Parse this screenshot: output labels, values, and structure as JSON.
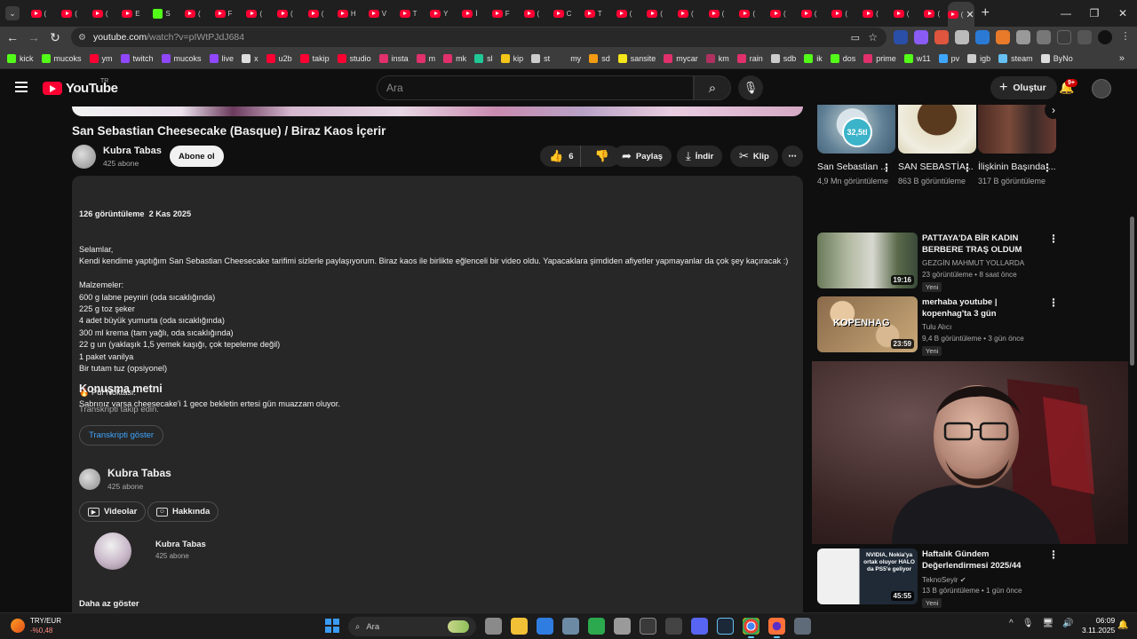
{
  "browser": {
    "tabs": [
      {
        "icon": "youtube",
        "letter": "("
      },
      {
        "icon": "youtube",
        "letter": "("
      },
      {
        "icon": "youtube",
        "letter": "("
      },
      {
        "icon": "youtube",
        "letter": "E"
      },
      {
        "icon": "kick",
        "letter": "S"
      },
      {
        "icon": "youtube",
        "letter": "("
      },
      {
        "icon": "youtube",
        "letter": "F"
      },
      {
        "icon": "youtube",
        "letter": "("
      },
      {
        "icon": "youtube",
        "letter": "("
      },
      {
        "icon": "youtube",
        "letter": "("
      },
      {
        "icon": "youtube",
        "letter": "H"
      },
      {
        "icon": "youtube",
        "letter": "V"
      },
      {
        "icon": "youtube",
        "letter": "T"
      },
      {
        "icon": "youtube",
        "letter": "Y"
      },
      {
        "icon": "youtube",
        "letter": "İ"
      },
      {
        "icon": "youtube",
        "letter": "F"
      },
      {
        "icon": "youtube",
        "letter": "("
      },
      {
        "icon": "youtube",
        "letter": "C"
      },
      {
        "icon": "youtube",
        "letter": "T"
      },
      {
        "icon": "youtube",
        "letter": "("
      },
      {
        "icon": "youtube",
        "letter": "("
      },
      {
        "icon": "youtube",
        "letter": "("
      },
      {
        "icon": "youtube",
        "letter": "("
      },
      {
        "icon": "youtube",
        "letter": "("
      },
      {
        "icon": "youtube",
        "letter": "("
      },
      {
        "icon": "youtube",
        "letter": "("
      },
      {
        "icon": "youtube",
        "letter": "("
      },
      {
        "icon": "youtube",
        "letter": "("
      },
      {
        "icon": "youtube",
        "letter": "("
      },
      {
        "icon": "youtube",
        "letter": "("
      }
    ],
    "active_tab_letter": "(",
    "url_host": "youtube.com",
    "url_rest": "/watch?v=pIWtPJdJ684",
    "bookmarks": [
      {
        "label": "kick",
        "color": "#53fc18"
      },
      {
        "label": "mucoks",
        "color": "#53fc18"
      },
      {
        "label": "ym",
        "color": "#ff0033"
      },
      {
        "label": "twitch",
        "color": "#9146ff"
      },
      {
        "label": "mucoks",
        "color": "#9146ff"
      },
      {
        "label": "live",
        "color": "#9146ff"
      },
      {
        "label": "x",
        "color": "#dddddd"
      },
      {
        "label": "u2b",
        "color": "#ff0033"
      },
      {
        "label": "takip",
        "color": "#ff0033"
      },
      {
        "label": "studio",
        "color": "#ff0033"
      },
      {
        "label": "insta",
        "color": "#e1306c"
      },
      {
        "label": "m",
        "color": "#e1306c"
      },
      {
        "label": "mk",
        "color": "#e1306c"
      },
      {
        "label": "sl",
        "color": "#20c997"
      },
      {
        "label": "kip",
        "color": "#f5c518"
      },
      {
        "label": "st",
        "color": "#cccccc"
      },
      {
        "label": "my",
        "color": "#3c3c3c"
      },
      {
        "label": "sd",
        "color": "#f39c12"
      },
      {
        "label": "sansite",
        "color": "#f5e61a"
      },
      {
        "label": "mycar",
        "color": "#e1306c"
      },
      {
        "label": "km",
        "color": "#b03060"
      },
      {
        "label": "rain",
        "color": "#e1306c"
      },
      {
        "label": "sdb",
        "color": "#cccccc"
      },
      {
        "label": "ik",
        "color": "#53fc18"
      },
      {
        "label": "dos",
        "color": "#53fc18"
      },
      {
        "label": "prime",
        "color": "#e1306c"
      },
      {
        "label": "w11",
        "color": "#53fc18"
      },
      {
        "label": "pv",
        "color": "#3ea6ff"
      },
      {
        "label": "igb",
        "color": "#cccccc"
      },
      {
        "label": "steam",
        "color": "#66c0f4"
      },
      {
        "label": "ByNo",
        "color": "#dddddd"
      }
    ]
  },
  "yt": {
    "logo_text": "YouTube",
    "logo_region": "TR",
    "search_placeholder": "Ara",
    "create_label": "Oluştur",
    "notif_count": "9+"
  },
  "video": {
    "title": "San Sebastian Cheesecake (Basque) / Biraz Kaos İçerir",
    "channel": "Kubra Tabas",
    "subs": "425 abone",
    "subscribe_label": "Abone ol",
    "likes": "6",
    "share_label": "Paylaş",
    "download_label": "İndir",
    "clip_label": "Klip"
  },
  "description": {
    "meta": "126 görüntüleme  2 Kas 2025",
    "lines": [
      "Selamlar,",
      "Kendi kendime yaptığım San Sebastian Cheesecake tarifimi sizlerle paylaşıyorum. Biraz kaos ile birlikte eğlenceli bir video oldu. Yapacaklara şimdiden afiyetler yapmayanlar da çok şey kaçıracak :)",
      "",
      "Malzemeler:",
      "600 g labne peyniri (oda sıcaklığında)",
      "225 g toz şeker",
      "4 adet büyük yumurta (oda sıcaklığında)",
      "300 ml krema (tam yağlı, oda sıcaklığında)",
      "22 g un (yaklaşık 1,5 yemek kaşığı, çok tepeleme değil)",
      "1 paket vanilya",
      "Bir tutam tuz (opsiyonel)",
      "",
      "🔥 Püf Noktası:",
      "Sabrınız varsa cheesecake'i 1 gece bekletin ertesi gün muazzam oluyor."
    ],
    "transcript_title": "Konuşma metni",
    "transcript_sub": "Transkripti takip edin.",
    "transcript_btn": "Transkripti göster",
    "channel_name": "Kubra Tabas",
    "channel_subs": "425 abone",
    "videos_btn": "Videolar",
    "about_btn": "Hakkında",
    "channel_card_name": "Kubra Tabas",
    "channel_card_subs": "425 abone",
    "show_less": "Daha az göster"
  },
  "shorts": [
    {
      "title": "San Sebastian ...",
      "views": "4,9 Mn görüntüleme",
      "badge": "32,5tl"
    },
    {
      "title": "SAN SEBASTİA...",
      "views": "863 B görüntüleme",
      "badge": ""
    },
    {
      "title": "İlişkinin Başında ...",
      "views": "317 B görüntüleme",
      "badge": ""
    }
  ],
  "recommendations": [
    {
      "title": "PATTAYA'DA BİR KADIN BERBERE TRAŞ OLDUM",
      "channel": "GEZGİN MAHMUT YOLLARDA",
      "meta": "23 görüntüleme • 8 saat önce",
      "new": "Yeni",
      "duration": "19:16",
      "thumb_text": ""
    },
    {
      "title": "merhaba youtube | kopenhag'ta 3 gün",
      "channel": "Tulu Alıcı",
      "meta": "9,4 B görüntüleme • 3 gün önce",
      "new": "Yeni",
      "duration": "23:59",
      "thumb_text": "KOPENHAG"
    },
    {
      "title": "Haftalık Gündem Değerlendirmesi 2025/44",
      "channel": "TeknoSeyir",
      "meta": "13 B görüntüleme • 1 gün önce",
      "new": "Yeni",
      "duration": "45:55",
      "thumb_text": "NVIDIA, Nokia'ya ortak oluyor HALO da PS5'e geliyor"
    }
  ],
  "taskbar": {
    "currency": "TRY/EUR",
    "change": "-%0,48",
    "search": "Ara",
    "time": "06:09",
    "date": "3.11.2025"
  }
}
